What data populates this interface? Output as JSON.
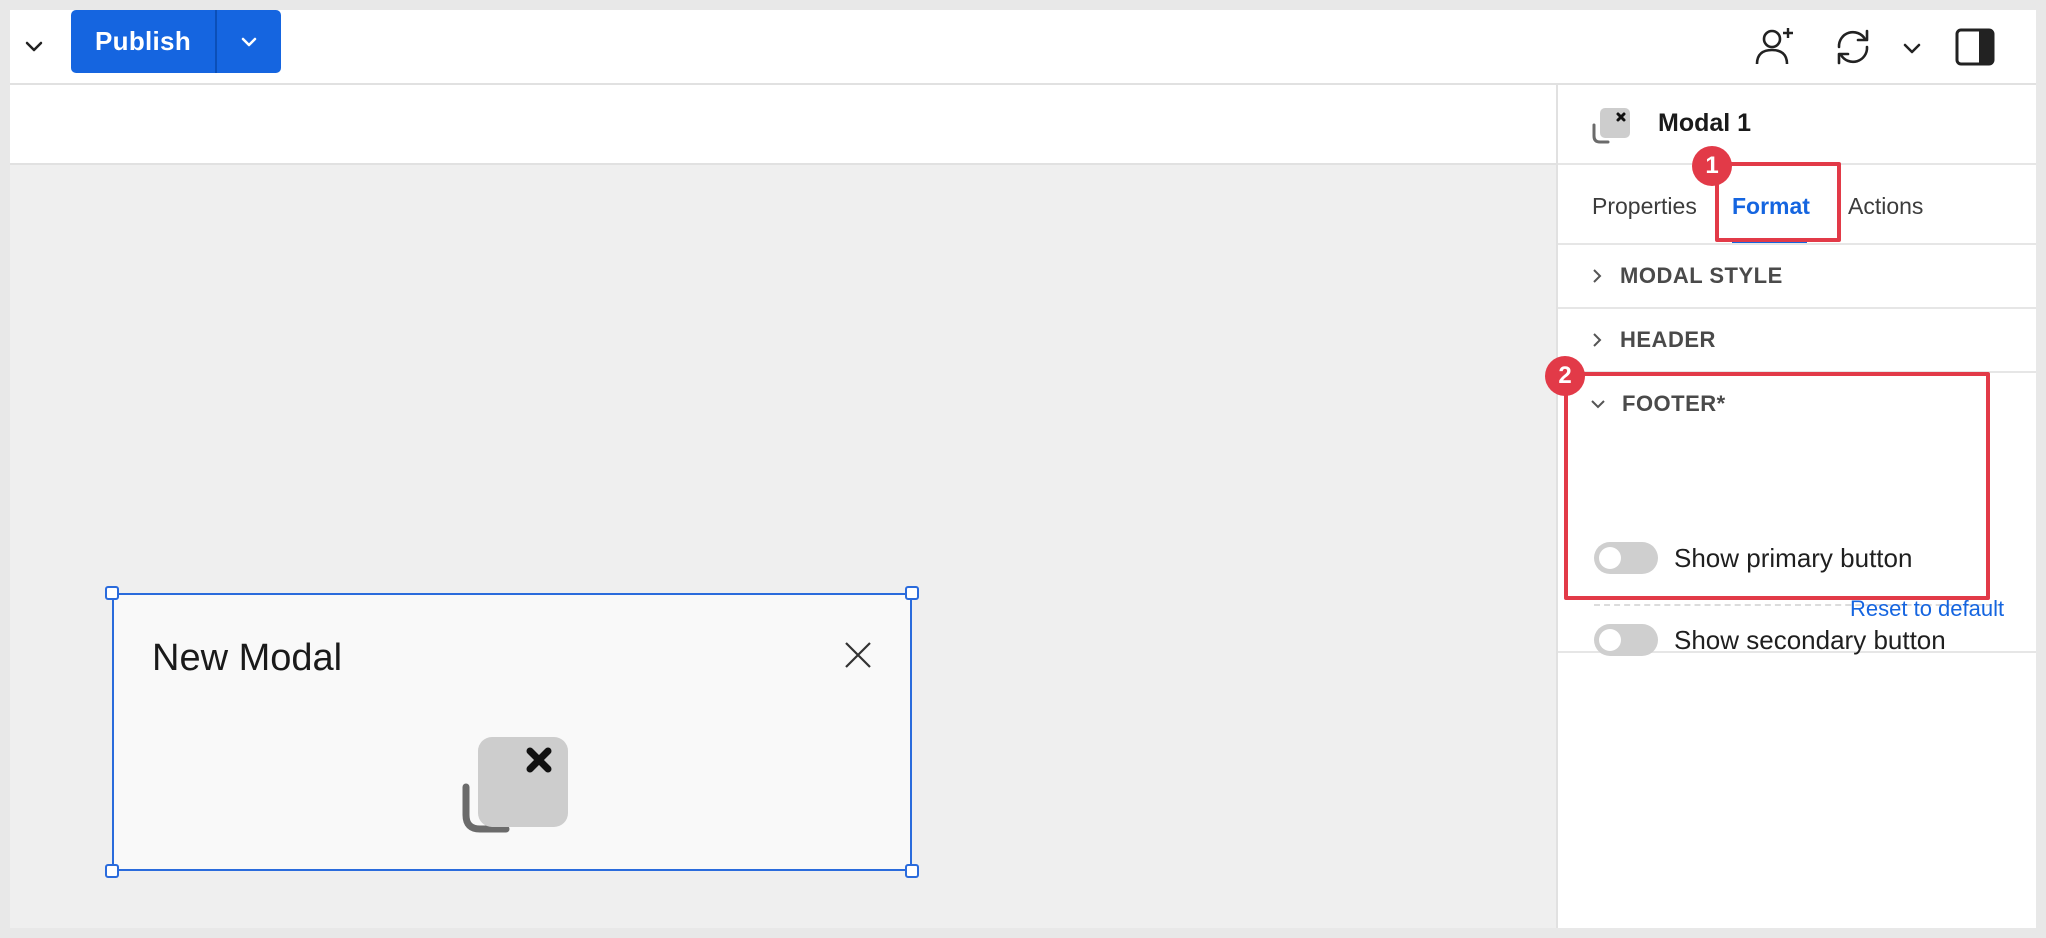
{
  "toolbar": {
    "publish_label": "Publish"
  },
  "panel": {
    "title": "Modal 1",
    "tabs": [
      {
        "label": "Properties"
      },
      {
        "label": "Format"
      },
      {
        "label": "Actions"
      }
    ],
    "sections": {
      "modal_style": "MODAL STYLE",
      "header": "HEADER",
      "footer": "FOOTER*"
    },
    "footer_options": [
      {
        "label": "Show primary button",
        "enabled": false
      },
      {
        "label": "Show secondary button",
        "enabled": false
      }
    ],
    "reset_label": "Reset to default"
  },
  "canvas": {
    "modal_title": "New Modal"
  },
  "callouts": {
    "one": "1",
    "two": "2"
  },
  "colors": {
    "accent": "#1565e0",
    "callout": "#e23a48",
    "selection": "#2a6bdc"
  },
  "icons": [
    "chevron-down-icon",
    "add-user-icon",
    "refresh-icon",
    "panel-toggle-icon",
    "modal-icon",
    "close-icon",
    "chevron-right-icon"
  ]
}
